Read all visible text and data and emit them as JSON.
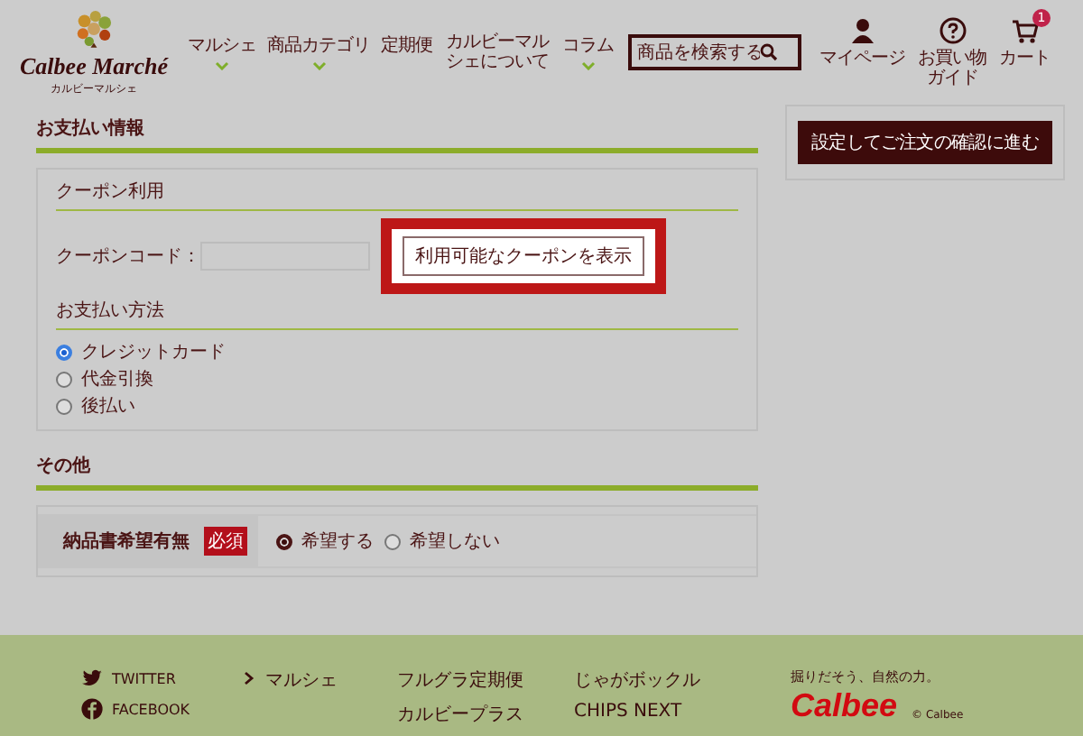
{
  "header": {
    "logo": {
      "title": "Calbee Marché",
      "subtitle": "カルビーマルシェ"
    },
    "nav": [
      {
        "label": "マルシェ",
        "dropdown": true
      },
      {
        "label": "商品カテゴリ",
        "dropdown": true
      },
      {
        "label": "定期便",
        "dropdown": false
      },
      {
        "label": "カルビーマルシェについて",
        "dropdown": false
      },
      {
        "label": "コラム",
        "dropdown": true
      }
    ],
    "search": {
      "placeholder": "商品を検索する"
    },
    "icons": [
      {
        "kind": "user",
        "label": "マイページ"
      },
      {
        "kind": "help",
        "label": "お買い物ガイド"
      },
      {
        "kind": "cart",
        "label": "カート",
        "badge": "1"
      }
    ]
  },
  "payment": {
    "title": "お支払い情報",
    "coupon": {
      "title": "クーポン利用",
      "code_label": "クーポンコード：",
      "button": "利用可能なクーポンを表示",
      "highlighted": true
    },
    "method": {
      "title": "お支払い方法",
      "options": [
        {
          "label": "クレジットカード",
          "selected": true
        },
        {
          "label": "代金引換",
          "selected": false
        },
        {
          "label": "後払い",
          "selected": false
        }
      ]
    }
  },
  "other": {
    "title": "その他",
    "fields": [
      {
        "label": "納品書希望有無",
        "required_badge": "必須",
        "options": [
          {
            "label": "希望する",
            "selected": true
          },
          {
            "label": "希望しない",
            "selected": false
          }
        ]
      }
    ]
  },
  "sidebar": {
    "button": "設定してご注文の確認に進む"
  },
  "footer": {
    "social": [
      {
        "kind": "twitter",
        "label": "TWITTER"
      },
      {
        "kind": "facebook",
        "label": "FACEBOOK"
      }
    ],
    "menu": {
      "label": "マルシェ"
    },
    "links_1": [
      "フルグラ定期便",
      "カルビープラス"
    ],
    "links_2": [
      "じゃがボックル",
      "CHIPS NEXT"
    ],
    "brand": {
      "tagline": "掘りだそう、自然の力。",
      "logo": "Calbee",
      "copyright": "© Calbee"
    }
  }
}
